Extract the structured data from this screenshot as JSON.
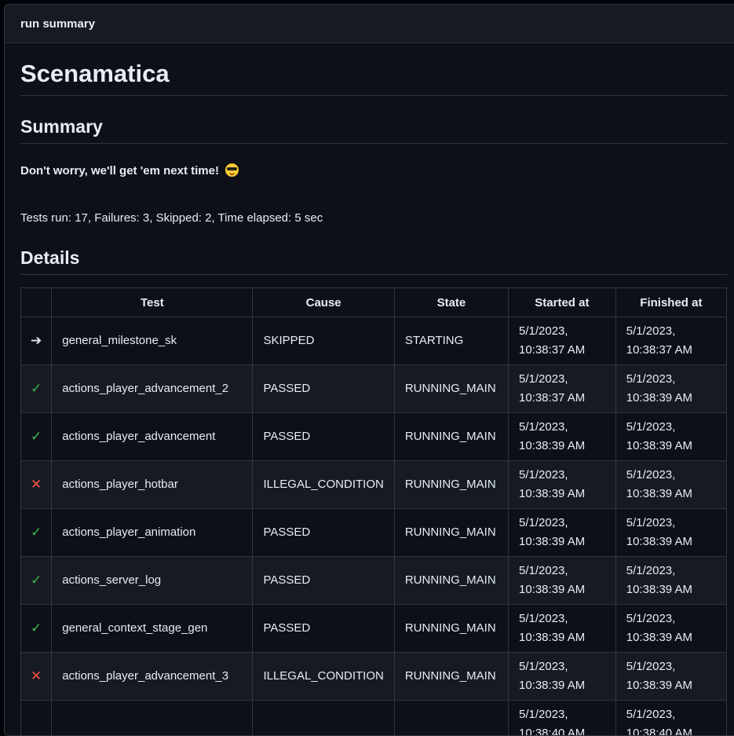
{
  "panel": {
    "title": "run summary"
  },
  "report": {
    "title": "Scenamatica",
    "summary_heading": "Summary",
    "tagline": "Don't worry, we'll get 'em next time!",
    "tagline_emoji": "smiling-face-with-sunglasses-icon",
    "stats": "Tests run: 17, Failures: 3, Skipped: 2, Time elapsed: 5 sec",
    "details_heading": "Details"
  },
  "table": {
    "headers": [
      "",
      "Test",
      "Cause",
      "State",
      "Started at",
      "Finished at"
    ],
    "rows": [
      {
        "icon": "arrow-right-icon",
        "glyph": "➔",
        "test": "general_milestone_sk",
        "cause": "SKIPPED",
        "state": "STARTING",
        "started": "5/1/2023, 10:38:37 AM",
        "finished": "5/1/2023, 10:38:37 AM"
      },
      {
        "icon": "check-icon",
        "glyph": "✓",
        "test": "actions_player_advancement_2",
        "cause": "PASSED",
        "state": "RUNNING_MAIN",
        "started": "5/1/2023, 10:38:37 AM",
        "finished": "5/1/2023, 10:38:39 AM"
      },
      {
        "icon": "check-icon",
        "glyph": "✓",
        "test": "actions_player_advancement",
        "cause": "PASSED",
        "state": "RUNNING_MAIN",
        "started": "5/1/2023, 10:38:39 AM",
        "finished": "5/1/2023, 10:38:39 AM"
      },
      {
        "icon": "cross-icon",
        "glyph": "✕",
        "test": "actions_player_hotbar",
        "cause": "ILLEGAL_CONDITION",
        "state": "RUNNING_MAIN",
        "started": "5/1/2023, 10:38:39 AM",
        "finished": "5/1/2023, 10:38:39 AM"
      },
      {
        "icon": "check-icon",
        "glyph": "✓",
        "test": "actions_player_animation",
        "cause": "PASSED",
        "state": "RUNNING_MAIN",
        "started": "5/1/2023, 10:38:39 AM",
        "finished": "5/1/2023, 10:38:39 AM"
      },
      {
        "icon": "check-icon",
        "glyph": "✓",
        "test": "actions_server_log",
        "cause": "PASSED",
        "state": "RUNNING_MAIN",
        "started": "5/1/2023, 10:38:39 AM",
        "finished": "5/1/2023, 10:38:39 AM"
      },
      {
        "icon": "check-icon",
        "glyph": "✓",
        "test": "general_context_stage_gen",
        "cause": "PASSED",
        "state": "RUNNING_MAIN",
        "started": "5/1/2023, 10:38:39 AM",
        "finished": "5/1/2023, 10:38:39 AM"
      },
      {
        "icon": "cross-icon",
        "glyph": "✕",
        "test": "actions_player_advancement_3",
        "cause": "ILLEGAL_CONDITION",
        "state": "RUNNING_MAIN",
        "started": "5/1/2023, 10:38:39 AM",
        "finished": "5/1/2023, 10:38:39 AM"
      },
      {
        "icon": "",
        "glyph": "",
        "test": "",
        "cause": "",
        "state": "",
        "started": "5/1/2023, 10:38:40 AM",
        "finished": "5/1/2023, 10:38:40 AM"
      }
    ]
  },
  "colors": {
    "pass": "#3fb950",
    "fail": "#f85149",
    "background": "#0d1117",
    "border": "#30363d"
  }
}
